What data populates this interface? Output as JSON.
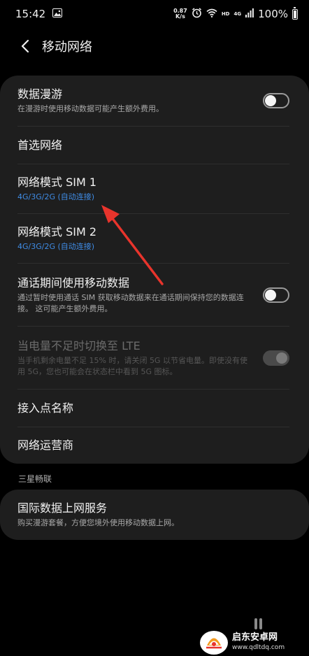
{
  "status_bar": {
    "time": "15:42",
    "net_speed_value": "0.87",
    "net_speed_unit": "K/s",
    "hd": "HD",
    "signal": "4G",
    "battery": "100%"
  },
  "header": {
    "title": "移动网络"
  },
  "settings": [
    {
      "title": "数据漫游",
      "subtitle": "在漫游时使用移动数据可能产生额外费用。",
      "toggle": "off"
    },
    {
      "title": "首选网络"
    },
    {
      "title": "网络模式 SIM 1",
      "subtitle": "4G/3G/2G (自动连接)"
    },
    {
      "title": "网络模式 SIM 2",
      "subtitle": "4G/3G/2G (自动连接)"
    },
    {
      "title": "通话期间使用移动数据",
      "subtitle": "通过暂时使用通话 SIM 获取移动数据来在通话期间保持您的数据连接。 这可能产生额外费用。",
      "toggle": "off"
    },
    {
      "title": "当电量不足时切换至 LTE",
      "subtitle": "当手机剩余电量不足 15% 时，请关闭 5G 以节省电量。即使没有使用 5G，您也可能会在状态栏中看到 5G 图标。",
      "toggle": "on",
      "disabled": true
    },
    {
      "title": "接入点名称"
    },
    {
      "title": "网络运营商"
    }
  ],
  "section": {
    "label": "三星畅联"
  },
  "bottom_item": {
    "title": "国际数据上网服务",
    "subtitle": "购买漫游套餐，方便您境外使用移动数据上网。"
  },
  "watermark": {
    "name": "启东安卓网",
    "url": "www.qdltdq.com"
  },
  "colors": {
    "background": "#000000",
    "card": "#1e1e1e",
    "accent_blue": "#3f8ce6",
    "annotation_red": "#e8342c"
  }
}
